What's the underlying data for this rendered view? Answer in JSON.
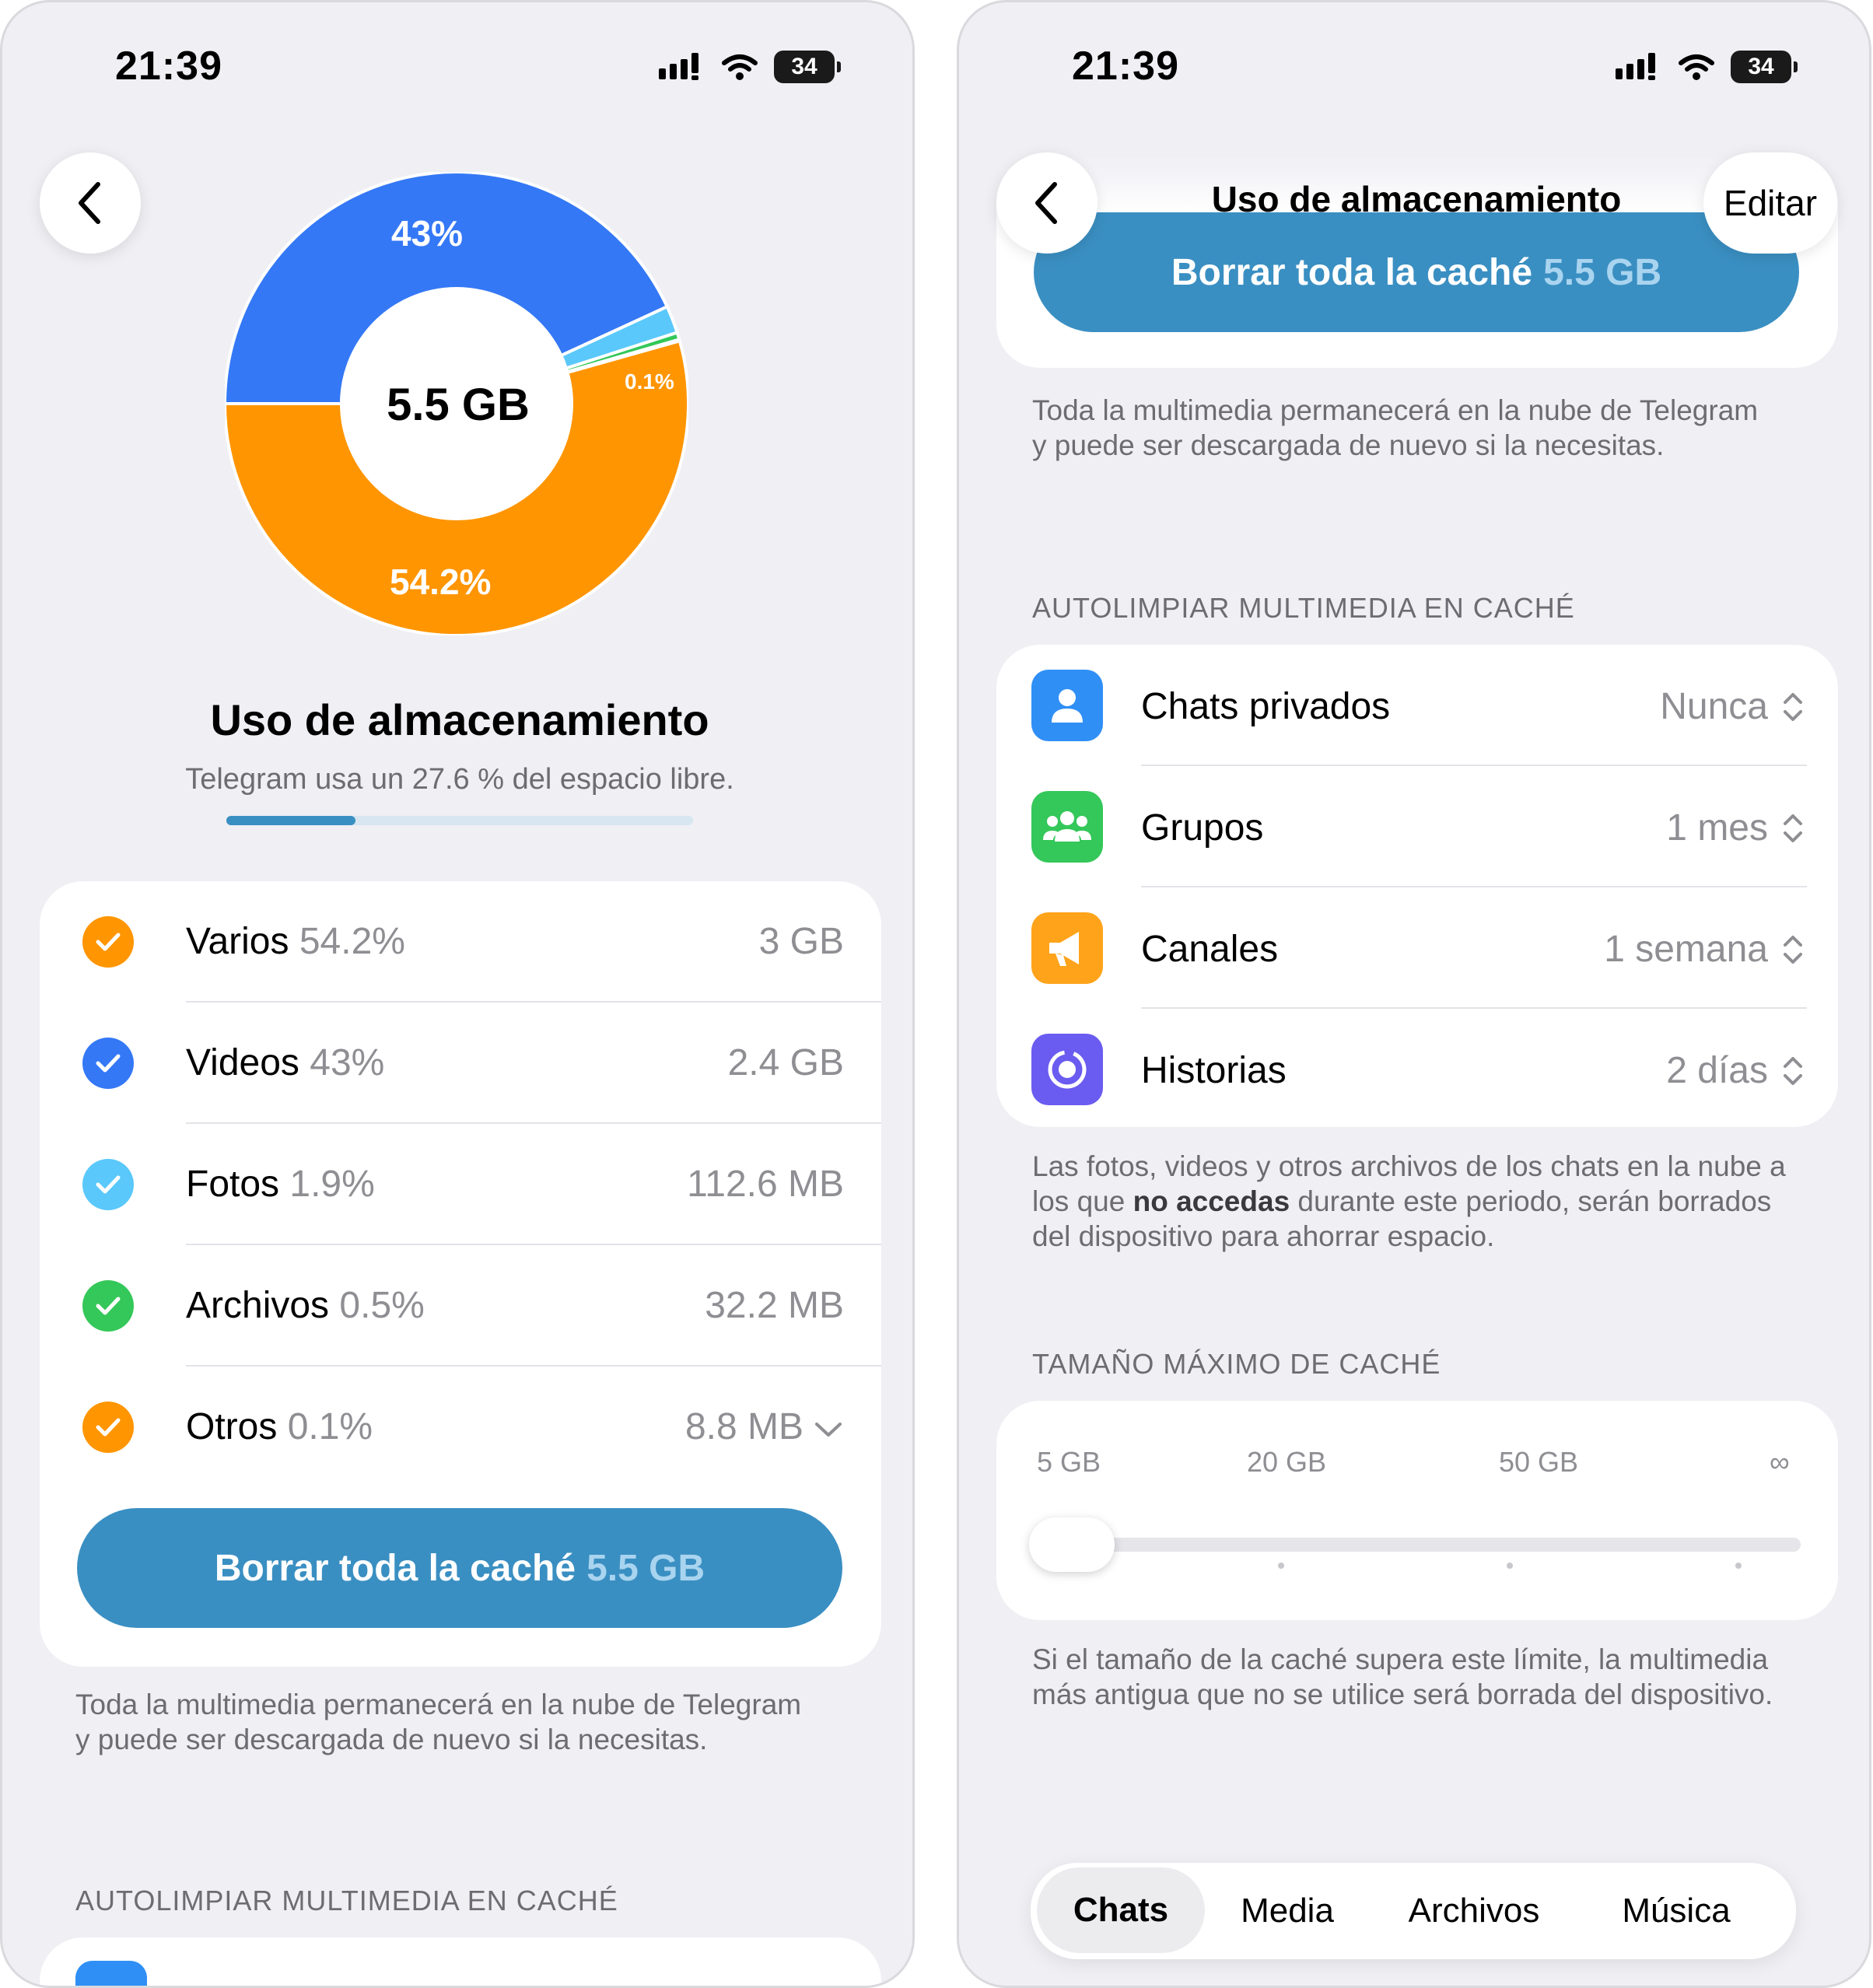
{
  "status": {
    "time": "21:39",
    "battery": "34"
  },
  "left": {
    "donut": {
      "total": "5.5 GB",
      "label_videos": "43%",
      "label_varios": "54.2%",
      "label_otros": "0.1%"
    },
    "title": "Uso de almacenamiento",
    "subtitle": "Telegram usa un 27.6 % del espacio libre.",
    "usage_fraction": 0.276,
    "items": [
      {
        "name": "Varios",
        "pct": "54.2%",
        "size": "3 GB",
        "color": "#ff9500"
      },
      {
        "name": "Videos",
        "pct": "43%",
        "size": "2.4 GB",
        "color": "#3478f6"
      },
      {
        "name": "Fotos",
        "pct": "1.9%",
        "size": "112.6 MB",
        "color": "#5ac8fa"
      },
      {
        "name": "Archivos",
        "pct": "0.5%",
        "size": "32.2 MB",
        "color": "#34c759"
      },
      {
        "name": "Otros",
        "pct": "0.1%",
        "size": "8.8 MB",
        "color": "#ff9500"
      }
    ],
    "clear_button": {
      "label": "Borrar toda la caché",
      "size": "5.5 GB"
    },
    "note": "Toda la multimedia permanecerá en la nube de Telegram y puede ser descargada de nuevo si la necesitas.",
    "section_autoclean": "AUTOLIMPIAR MULTIMEDIA EN CACHÉ"
  },
  "right": {
    "nav_title": "Uso de almacenamiento",
    "edit_label": "Editar",
    "clear_button": {
      "label": "Borrar toda la caché",
      "size": "5.5 GB"
    },
    "note": "Toda la multimedia permanecerá en la nube de Telegram y puede ser descargada de nuevo si la necesitas.",
    "section_autoclean": "AUTOLIMPIAR MULTIMEDIA EN CACHÉ",
    "autoclean": [
      {
        "label": "Chats privados",
        "value": "Nunca",
        "icon": "person-icon",
        "color": "#2f8ff5"
      },
      {
        "label": "Grupos",
        "value": "1 mes",
        "icon": "group-icon",
        "color": "#34c759"
      },
      {
        "label": "Canales",
        "value": "1 semana",
        "icon": "megaphone-icon",
        "color": "#ffa31a"
      },
      {
        "label": "Historias",
        "value": "2 días",
        "icon": "stories-icon",
        "color": "#6a5cf0"
      }
    ],
    "autoclean_note_1": "Las fotos, videos y otros archivos de los chats en la nube a los que ",
    "autoclean_note_bold": "no accedas",
    "autoclean_note_2": " durante este periodo, serán borrados del dispositivo para ahorrar espacio.",
    "section_maxsize": "TAMAÑO MÁXIMO DE CACHÉ",
    "slider_ticks": [
      "5 GB",
      "20 GB",
      "50 GB",
      "∞"
    ],
    "slider_value": "5 GB",
    "maxsize_note": "Si el tamaño de la caché supera este límite, la multimedia más antigua que no se utilice será borrada del dispositivo.",
    "tabs": [
      "Chats",
      "Media",
      "Archivos",
      "Música"
    ],
    "active_tab": "Chats"
  }
}
